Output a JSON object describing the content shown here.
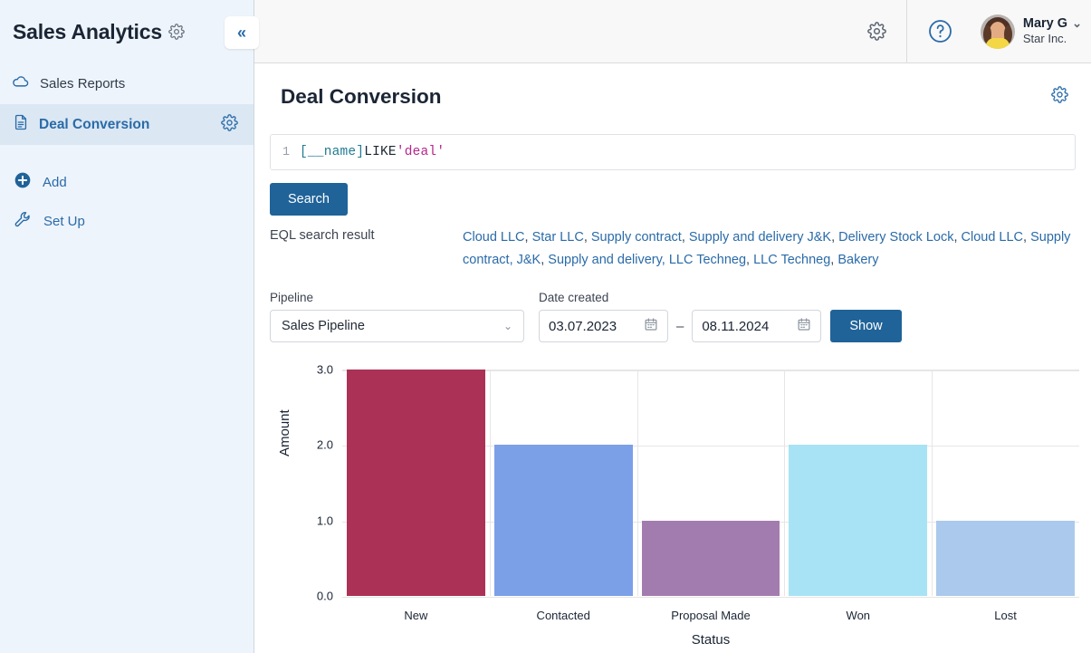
{
  "sidebar": {
    "brand_title": "Sales Analytics",
    "brand_gear_icon": "gear-icon",
    "collapse_icon": "«",
    "items": [
      {
        "label": "Sales Reports",
        "icon": "cloud-icon",
        "active": false
      },
      {
        "label": "Deal Conversion",
        "icon": "document-icon",
        "active": true,
        "gear_icon": "gear-icon"
      }
    ],
    "actions": [
      {
        "label": "Add",
        "icon": "plus-circle-icon"
      },
      {
        "label": "Set Up",
        "icon": "wrench-icon"
      }
    ]
  },
  "topbar": {
    "gear_icon": "gear-icon",
    "help_icon": "question-circle-icon",
    "user_name": "Mary G",
    "user_org": "Star Inc.",
    "user_caret": "⌄",
    "avatar_icon": "avatar"
  },
  "page": {
    "title": "Deal Conversion",
    "gear_icon": "gear-icon"
  },
  "editor": {
    "line_number": "1",
    "token_field": "[__name]",
    "token_keyword": " LIKE ",
    "token_string": "'deal'"
  },
  "actions": {
    "search_label": "Search",
    "show_label": "Show"
  },
  "result": {
    "label": "EQL search result",
    "items": [
      "Cloud LLC",
      "Star LLC",
      "Supply contract",
      "Supply and delivery J&K",
      "Delivery Stock Lock",
      "Cloud LLC",
      "Supply contract, J&K",
      "Supply and delivery, LLC Techneg",
      "LLC Techneg",
      "Bakery"
    ],
    "separator": ","
  },
  "filters": {
    "pipeline_label": "Pipeline",
    "pipeline_value": "Sales Pipeline",
    "pipeline_caret": "⌄",
    "date_label": "Date created",
    "date_from": "03.07.2023",
    "date_to": "08.11.2024",
    "date_dash": "–",
    "calendar_icon": "calendar-icon"
  },
  "chart_data": {
    "type": "bar",
    "title": "",
    "xlabel": "Status",
    "ylabel": "Amount",
    "categories": [
      "New",
      "Contacted",
      "Proposal Made",
      "Won",
      "Lost"
    ],
    "values": [
      3.0,
      2.0,
      1.0,
      2.0,
      1.0
    ],
    "colors": [
      "#ab3256",
      "#7ba0e8",
      "#a37caf",
      "#a7e3f5",
      "#aac9ec"
    ],
    "ylim": [
      0.0,
      3.0
    ],
    "yticks": [
      "0.0",
      "1.0",
      "2.0",
      "3.0"
    ],
    "ytick_values": [
      0.0,
      1.0,
      2.0,
      3.0
    ],
    "grid": true,
    "legend": "none"
  },
  "colors": {
    "accent": "#2a6ba8",
    "button": "#1f6399",
    "sidebar_bg": "#eef4fb",
    "sidebar_active_bg": "#dbe7f3",
    "topbar_bg": "#f8f8f8"
  }
}
